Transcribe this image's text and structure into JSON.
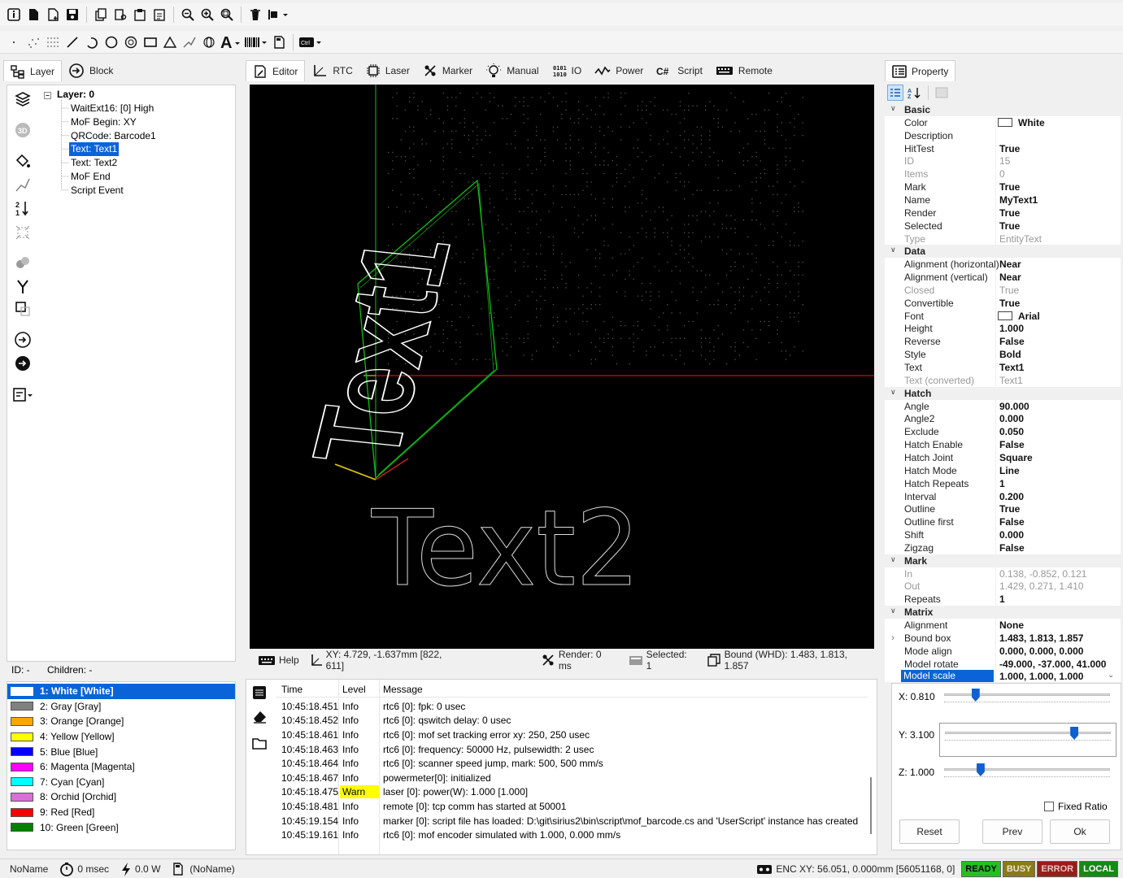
{
  "left_tabs": {
    "layer": "Layer",
    "block": "Block"
  },
  "tree": {
    "root": "Layer: 0",
    "items": [
      "WaitExt16: [0] High",
      "MoF Begin: XY",
      "QRCode: Barcode1",
      "Text: Text1",
      "Text: Text2",
      "MoF End",
      "Script Event"
    ]
  },
  "id_line": {
    "id": "ID: -",
    "children": "Children: -"
  },
  "colors": [
    {
      "label": "1: White [White]",
      "hex": "#ffffff"
    },
    {
      "label": "2: Gray [Gray]",
      "hex": "#808080"
    },
    {
      "label": "3: Orange [Orange]",
      "hex": "#ffa500"
    },
    {
      "label": "4: Yellow [Yellow]",
      "hex": "#ffff00"
    },
    {
      "label": "5: Blue [Blue]",
      "hex": "#0000ff"
    },
    {
      "label": "6: Magenta [Magenta]",
      "hex": "#ff00ff"
    },
    {
      "label": "7: Cyan [Cyan]",
      "hex": "#00ffff"
    },
    {
      "label": "8: Orchid [Orchid]",
      "hex": "#da70d6"
    },
    {
      "label": "9: Red [Red]",
      "hex": "#ff0000"
    },
    {
      "label": "10: Green [Green]",
      "hex": "#008000"
    }
  ],
  "center_tabs": [
    "Editor",
    "RTC",
    "Laser",
    "Marker",
    "Manual",
    "IO",
    "Power",
    "Script",
    "Remote"
  ],
  "canvas": {
    "text1": "Text1",
    "text2": "Text2"
  },
  "editor_status": {
    "help": "Help",
    "xy": "XY: 4.729, -1.637mm [822, 611]",
    "render": "Render: 0 ms",
    "selected": "Selected: 1",
    "bound": "Bound (WHD): 1.483, 1.813, 1.857"
  },
  "log": {
    "headers": {
      "time": "Time",
      "level": "Level",
      "message": "Message"
    },
    "rows": [
      {
        "time": "10:45:18.451",
        "level": "Info",
        "message": "rtc6 [0]: fpk: 0 usec"
      },
      {
        "time": "10:45:18.452",
        "level": "Info",
        "message": "rtc6 [0]: qswitch delay: 0 usec"
      },
      {
        "time": "10:45:18.461",
        "level": "Info",
        "message": "rtc6 [0]: mof set tracking error xy: 250, 250 usec"
      },
      {
        "time": "10:45:18.463",
        "level": "Info",
        "message": "rtc6 [0]: frequency: 50000 Hz, pulsewidth: 2 usec"
      },
      {
        "time": "10:45:18.464",
        "level": "Info",
        "message": "rtc6 [0]: scanner speed jump, mark: 500, 500 mm/s"
      },
      {
        "time": "10:45:18.467",
        "level": "Info",
        "message": "powermeter[0]: initialized"
      },
      {
        "time": "10:45:18.475",
        "level": "Warn",
        "message": "laser [0]: power(W): 1.000 [1.000]"
      },
      {
        "time": "10:45:18.481",
        "level": "Info",
        "message": "remote [0]: tcp comm has started at 50001"
      },
      {
        "time": "10:45:19.154",
        "level": "Info",
        "message": "marker [0]: script file has loaded: D:\\git\\sirius2\\bin\\script\\mof_barcode.cs and 'UserScript' instance has created"
      },
      {
        "time": "10:45:19.161",
        "level": "Info",
        "message": "rtc6 [0]: mof encoder simulated with 1.000, 0.000 mm/s"
      }
    ]
  },
  "property": {
    "title": "Property",
    "rows": [
      {
        "type": "cat",
        "k": "Basic"
      },
      {
        "k": "Color",
        "v": "White",
        "swatch": "#ffffff"
      },
      {
        "k": "Description",
        "v": ""
      },
      {
        "k": "HitTest",
        "v": "True"
      },
      {
        "k": "ID",
        "v": "15",
        "dis": true
      },
      {
        "k": "Items",
        "v": "0",
        "dis": true
      },
      {
        "k": "Mark",
        "v": "True"
      },
      {
        "k": "Name",
        "v": "MyText1"
      },
      {
        "k": "Render",
        "v": "True"
      },
      {
        "k": "Selected",
        "v": "True"
      },
      {
        "k": "Type",
        "v": "EntityText",
        "dis": true
      },
      {
        "type": "cat",
        "k": "Data"
      },
      {
        "k": "Alignment (horizontal)",
        "v": "Near"
      },
      {
        "k": "Alignment (vertical)",
        "v": "Near"
      },
      {
        "k": "Closed",
        "v": "True",
        "dis": true
      },
      {
        "k": "Convertible",
        "v": "True"
      },
      {
        "k": "Font",
        "v": "Arial",
        "swatch": "#ffffff"
      },
      {
        "k": "Height",
        "v": "1.000"
      },
      {
        "k": "Reverse",
        "v": "False"
      },
      {
        "k": "Style",
        "v": "Bold"
      },
      {
        "k": "Text",
        "v": "Text1"
      },
      {
        "k": "Text (converted)",
        "v": "Text1",
        "dis": true
      },
      {
        "type": "cat",
        "k": "Hatch"
      },
      {
        "k": "Angle",
        "v": "90.000"
      },
      {
        "k": "Angle2",
        "v": "0.000"
      },
      {
        "k": "Exclude",
        "v": "0.050"
      },
      {
        "k": "Hatch Enable",
        "v": "False"
      },
      {
        "k": "Hatch Joint",
        "v": "Square"
      },
      {
        "k": "Hatch Mode",
        "v": "Line"
      },
      {
        "k": "Hatch Repeats",
        "v": "1"
      },
      {
        "k": "Interval",
        "v": "0.200"
      },
      {
        "k": "Outline",
        "v": "True"
      },
      {
        "k": "Outline first",
        "v": "False"
      },
      {
        "k": "Shift",
        "v": "0.000"
      },
      {
        "k": "Zigzag",
        "v": "False"
      },
      {
        "type": "cat",
        "k": "Mark"
      },
      {
        "k": "In",
        "v": "0.138, -0.852, 0.121",
        "dis": true
      },
      {
        "k": "Out",
        "v": "1.429, 0.271, 1.410",
        "dis": true
      },
      {
        "k": "Repeats",
        "v": "1"
      },
      {
        "type": "cat",
        "k": "Matrix"
      },
      {
        "k": "Alignment",
        "v": "None"
      },
      {
        "k": "Bound box",
        "v": "1.483, 1.813, 1.857",
        "expand": true
      },
      {
        "k": "Mode align",
        "v": "0.000, 0.000, 0.000"
      },
      {
        "k": "Model rotate",
        "v": "-49.000, -37.000, 41.000"
      },
      {
        "k": "Model scale",
        "v": "1.000, 1.000, 1.000",
        "sel": true
      }
    ]
  },
  "sliders": {
    "x": "X: 0.810",
    "y": "Y: 3.100",
    "z": "Z: 1.000",
    "x_val": 0.19,
    "y_val": 0.78,
    "z_val": 0.22,
    "fixed_ratio": "Fixed Ratio"
  },
  "buttons": {
    "reset": "Reset",
    "prev": "Prev",
    "ok": "Ok"
  },
  "statusbar": {
    "name": "NoName",
    "time": "0 msec",
    "power": "0.0 W",
    "file": "(NoName)",
    "enc": "ENC XY: 56.051, 0.000mm [56051168, 0]",
    "ready": "READY",
    "busy": "BUSY",
    "error": "ERROR",
    "local": "LOCAL"
  }
}
